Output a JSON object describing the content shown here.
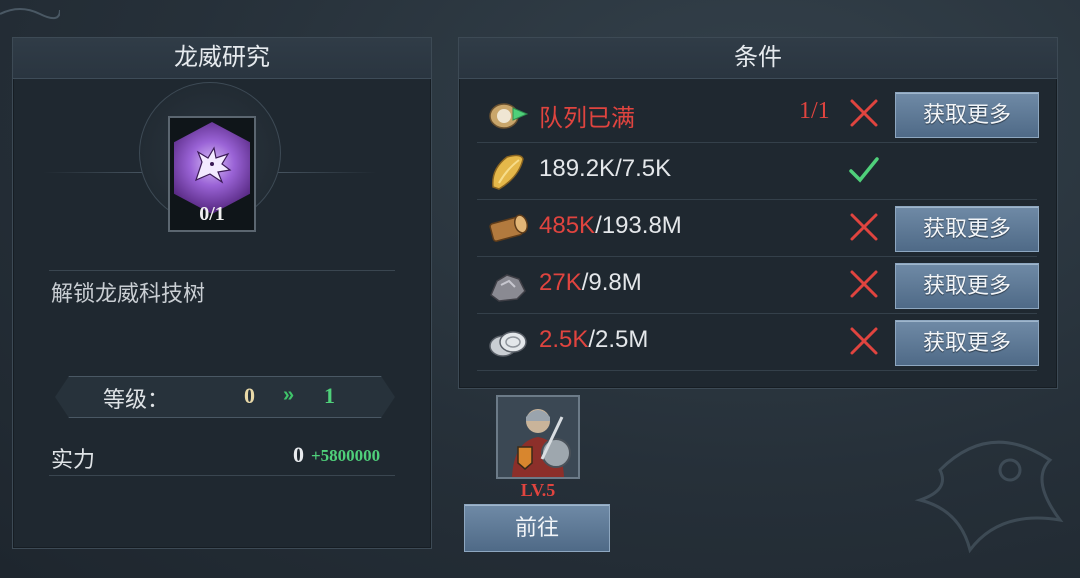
{
  "left_panel": {
    "title": "龙威研究",
    "emblem_count": "0/1",
    "unlock_text": "解锁龙威科技树",
    "level": {
      "label": "等级：",
      "from": "0",
      "arrow": "»",
      "to": "1"
    },
    "power": {
      "label": "实力",
      "value": "0",
      "bonus": "+5800000"
    }
  },
  "right_panel": {
    "title": "条件",
    "rows": [
      {
        "icon": "queue-icon",
        "text_red": "队列已满",
        "text_white": "",
        "count": "1/1",
        "status": "fail",
        "button": "获取更多"
      },
      {
        "icon": "food-icon",
        "text_red": "",
        "text_white": "189.2K/7.5K",
        "count": "",
        "status": "ok",
        "button": ""
      },
      {
        "icon": "wood-icon",
        "text_red": "485K",
        "text_white": "/193.8M",
        "count": "",
        "status": "fail",
        "button": "获取更多"
      },
      {
        "icon": "stone-icon",
        "text_red": "27K",
        "text_white": "/9.8M",
        "count": "",
        "status": "fail",
        "button": "获取更多"
      },
      {
        "icon": "silver-icon",
        "text_red": "2.5K",
        "text_white": "/2.5M",
        "count": "",
        "status": "fail",
        "button": "获取更多"
      }
    ]
  },
  "hero": {
    "level": "LV.5",
    "go_label": "前往"
  },
  "colors": {
    "red": "#e0443f",
    "green": "#4fd07a",
    "button": "#5f7a97",
    "panel": "#1f2830"
  }
}
